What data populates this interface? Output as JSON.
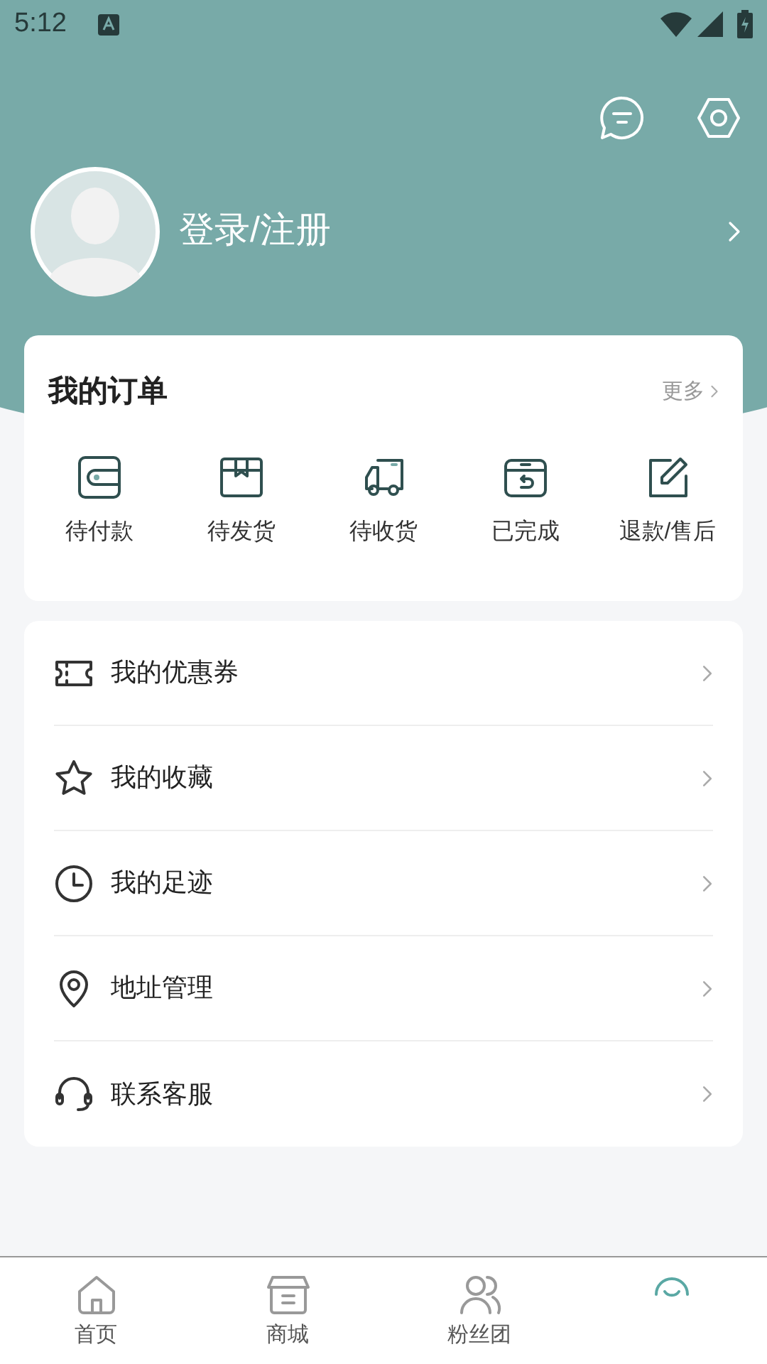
{
  "status_bar": {
    "time": "5:12"
  },
  "profile": {
    "login_label": "登录/注册"
  },
  "orders": {
    "title": "我的订单",
    "more": "更多",
    "items": [
      {
        "kind": "wallet",
        "label": "待付款"
      },
      {
        "kind": "box",
        "label": "待发货"
      },
      {
        "kind": "truck",
        "label": "待收货"
      },
      {
        "kind": "done",
        "label": "已完成"
      },
      {
        "kind": "edit",
        "label": "退款/售后"
      }
    ]
  },
  "menu": [
    {
      "kind": "coupon",
      "label": "我的优惠券"
    },
    {
      "kind": "star",
      "label": "我的收藏"
    },
    {
      "kind": "clock",
      "label": "我的足迹"
    },
    {
      "kind": "pin",
      "label": "地址管理"
    },
    {
      "kind": "headset",
      "label": "联系客服"
    }
  ],
  "bottom_nav": [
    {
      "kind": "home",
      "label": "首页",
      "selected": false
    },
    {
      "kind": "shop",
      "label": "商城",
      "selected": false
    },
    {
      "kind": "fans",
      "label": "粉丝团",
      "selected": false
    },
    {
      "kind": "me",
      "selected": true
    }
  ]
}
